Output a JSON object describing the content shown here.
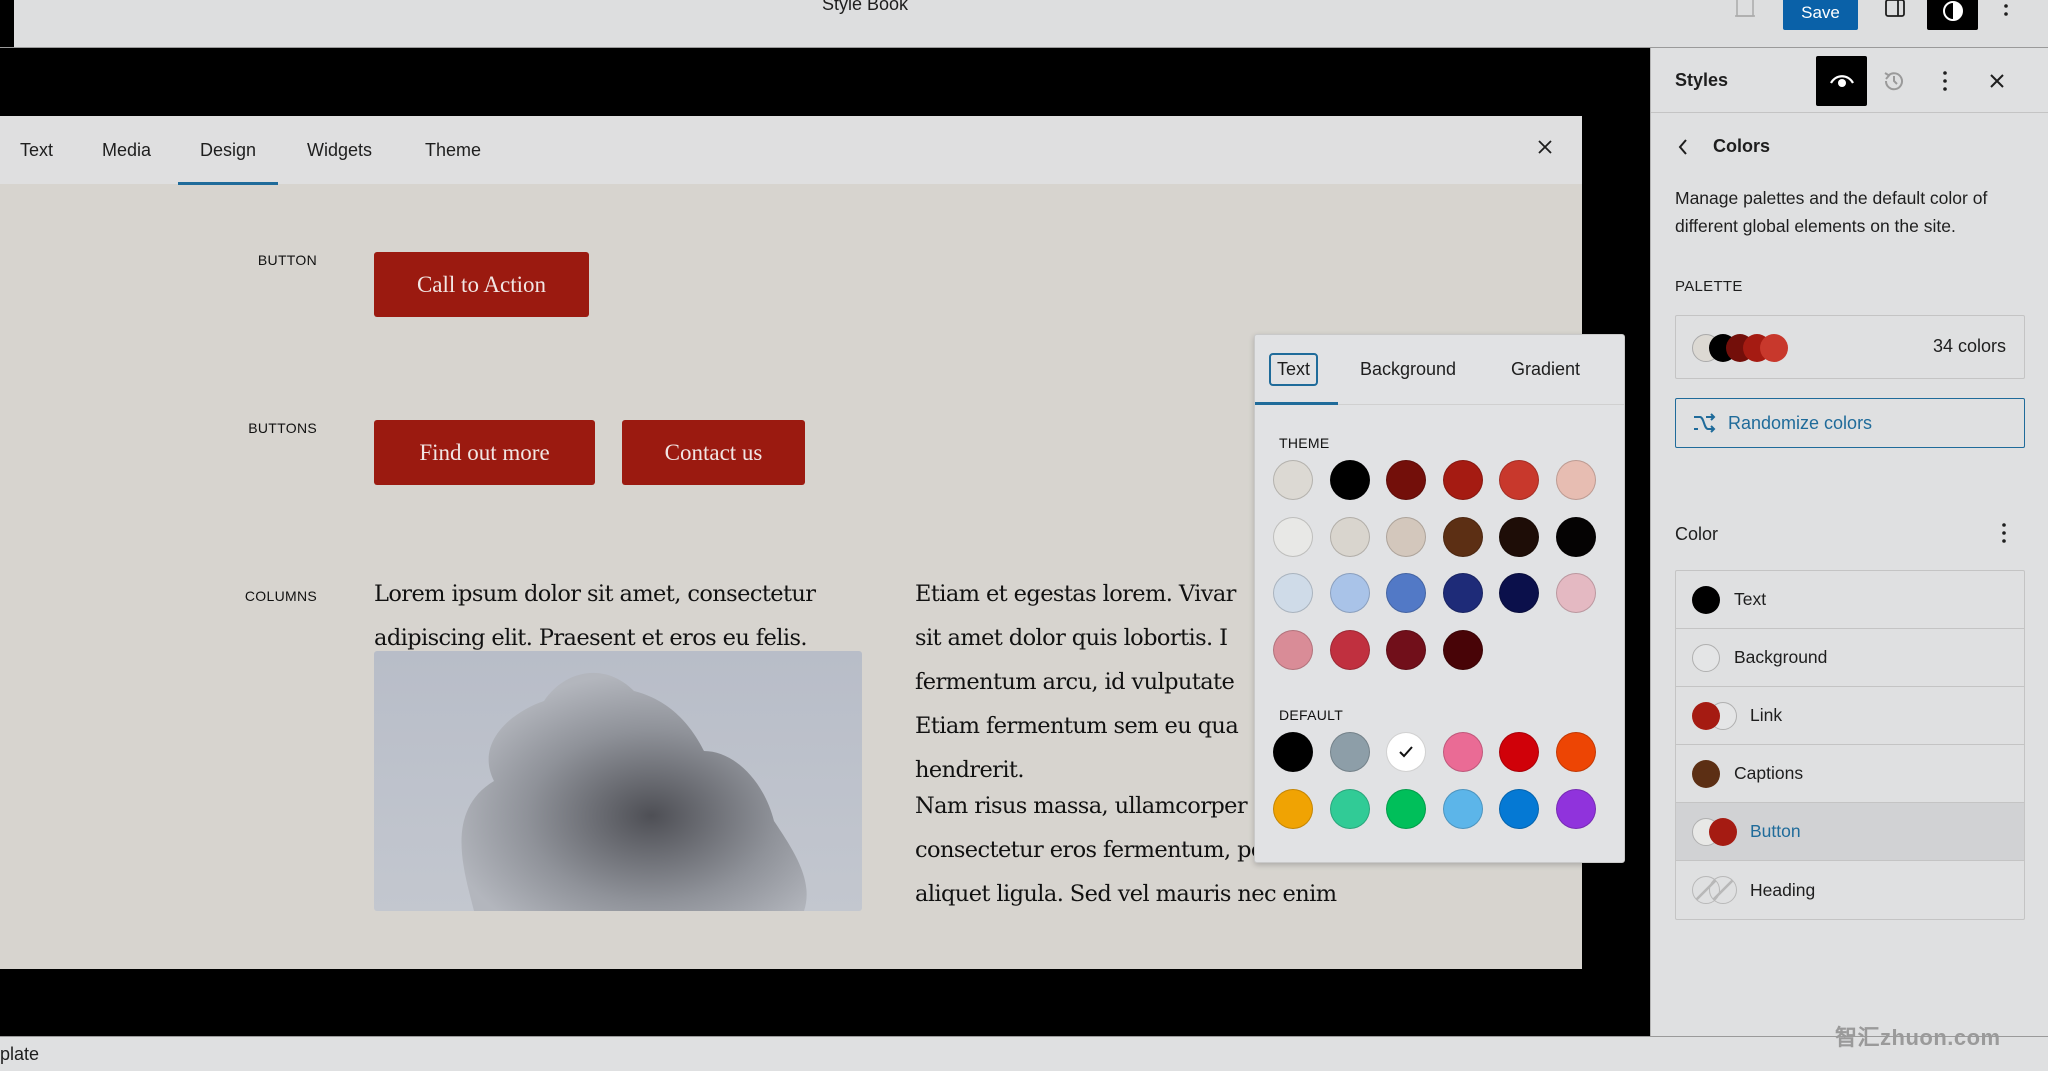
{
  "topbar": {
    "title": "Style Book",
    "save_label": "Save",
    "icons": [
      "preview-icon",
      "save-button",
      "sidebar-toggle-icon",
      "styles-icon",
      "more-options-icon"
    ]
  },
  "stylebook": {
    "tabs": [
      {
        "label": "Text",
        "active": false
      },
      {
        "label": "Media",
        "active": false
      },
      {
        "label": "Design",
        "active": true
      },
      {
        "label": "Widgets",
        "active": false
      },
      {
        "label": "Theme",
        "active": false
      }
    ],
    "sections": {
      "button_label": "BUTTON",
      "buttons_label": "BUTTONS",
      "columns_label": "COLUMNS"
    },
    "button_text": "Call to Action",
    "buttons": [
      "Find out more",
      "Contact us"
    ],
    "column1_text": "Lorem ipsum dolor sit amet, consectetur\nadipiscing elit. Praesent et eros eu felis.",
    "column2_text": "Etiam et egestas lorem. Vivar\nsit amet dolor quis lobortis. I\nfermentum arcu, id vulputate\nEtiam fermentum sem eu qua\nhendrerit.",
    "column2_text_b": "Nam risus massa, ullamcorper\nconsectetur eros fermentum, porta\naliquet ligula. Sed vel mauris nec enim",
    "image_alt": "frosted tree against grey sky",
    "button_color": "#9b1a10"
  },
  "color_popover": {
    "tabs": [
      {
        "label": "Text",
        "active": true
      },
      {
        "label": "Background",
        "active": false
      },
      {
        "label": "Gradient",
        "active": false
      }
    ],
    "theme_label": "THEME",
    "default_label": "DEFAULT",
    "theme_colors": [
      "#dcd9d3",
      "#000000",
      "#730f0a",
      "#a51b12",
      "#c8382c",
      "#e7bdb2",
      "#e8e8e6",
      "#d9d5ce",
      "#d3c7bc",
      "#5c2f14",
      "#1e0d07",
      "#050303",
      "#cfdbe8",
      "#a9c3e8",
      "#5279c6",
      "#1e2b78",
      "#0b104b",
      "#e4b9c2",
      "#d98c97",
      "#c0303f",
      "#710f1a",
      "#480407"
    ],
    "default_colors": [
      {
        "color": "#000000",
        "selected": false
      },
      {
        "color": "#8d9ea8",
        "selected": false
      },
      {
        "color": "#ffffff",
        "selected": true
      },
      {
        "color": "#ea6b95",
        "selected": false
      },
      {
        "color": "#d00109",
        "selected": false
      },
      {
        "color": "#ed4504",
        "selected": false
      },
      {
        "color": "#f0a303",
        "selected": false
      },
      {
        "color": "#31cb96",
        "selected": false
      },
      {
        "color": "#00bf5a",
        "selected": false
      },
      {
        "color": "#5cb5e9",
        "selected": false
      },
      {
        "color": "#0579d4",
        "selected": false
      },
      {
        "color": "#9033dc",
        "selected": false
      }
    ]
  },
  "sidebar": {
    "title": "Styles",
    "back_title": "Colors",
    "description": "Manage palettes and the default color of different global elements on the site.",
    "palette_label": "PALETTE",
    "palette_preview": [
      "#dcd9d3",
      "#000000",
      "#730f0a",
      "#a51b12",
      "#c8382c"
    ],
    "palette_count": "34 colors",
    "randomize_label": "Randomize colors",
    "color_heading": "Color",
    "elements": [
      {
        "label": "Text",
        "colors": [
          "#000000"
        ],
        "active": false
      },
      {
        "label": "Background",
        "colors": [
          "transparent"
        ],
        "active": false
      },
      {
        "label": "Link",
        "colors": [
          "#a51b12",
          "transparent"
        ],
        "active": false
      },
      {
        "label": "Captions",
        "colors": [
          "#5c2f14"
        ],
        "active": false
      },
      {
        "label": "Button",
        "colors": [
          "#e8e8e6",
          "#a51b12"
        ],
        "active": true
      },
      {
        "label": "Heading",
        "colors": [
          "none",
          "none"
        ],
        "active": false
      }
    ]
  },
  "status_bar": {
    "text": "plate"
  },
  "watermark": "智汇zhuon.com",
  "accent_color": "#1f6b9a"
}
